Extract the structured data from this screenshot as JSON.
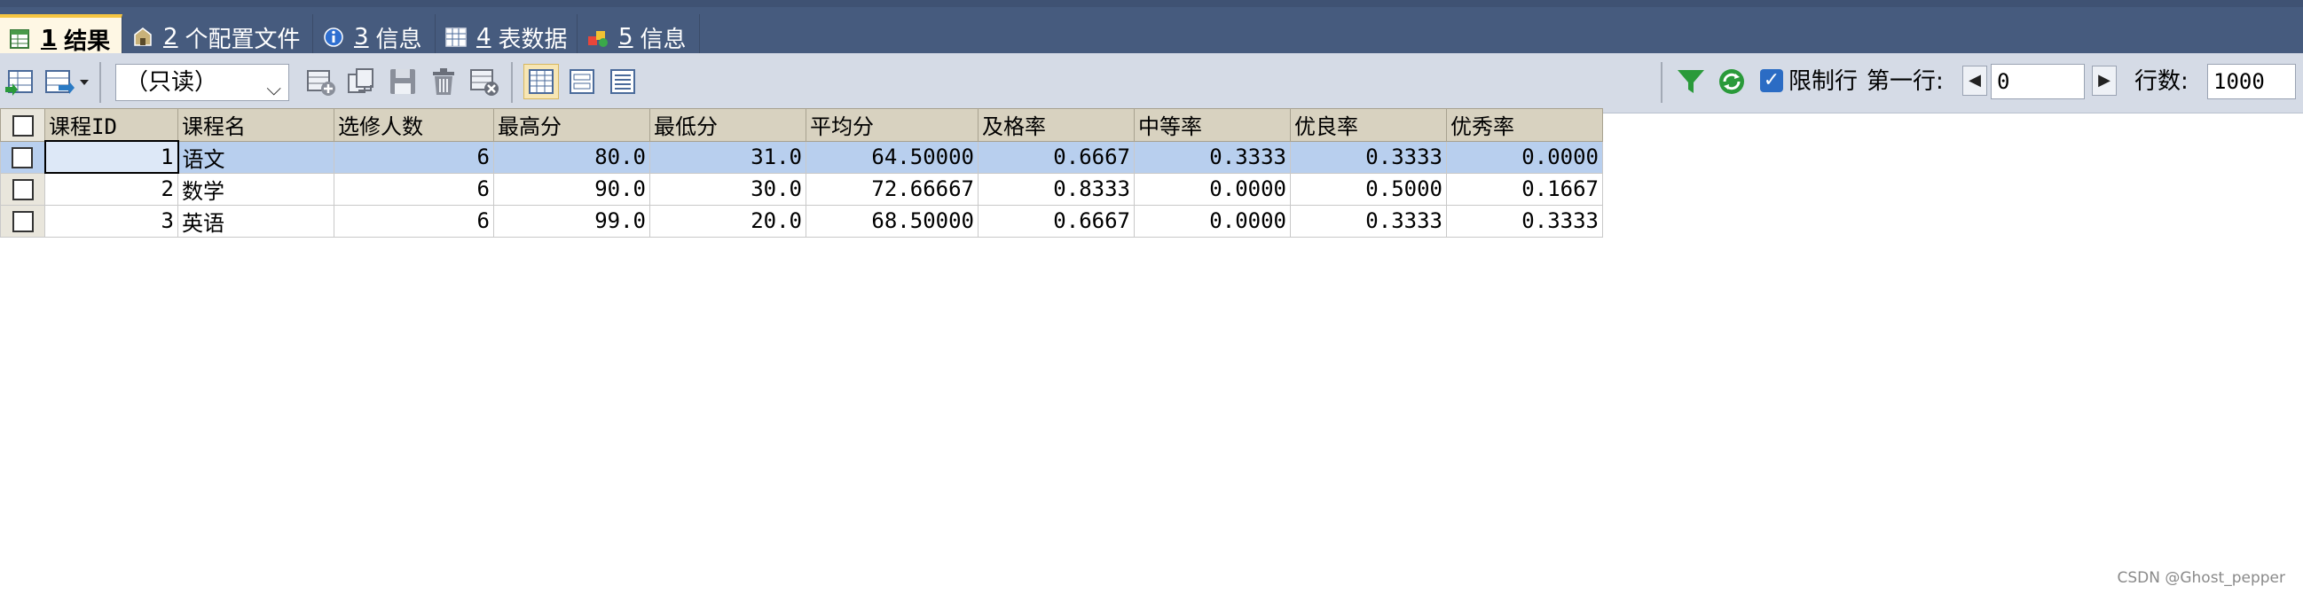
{
  "tabs": [
    {
      "num": "1",
      "label": "结果",
      "icon": "result-grid-icon"
    },
    {
      "num": "2",
      "label": "个配置文件",
      "icon": "profile-icon"
    },
    {
      "num": "3",
      "label": "信息",
      "icon": "info-icon"
    },
    {
      "num": "4",
      "label": "表数据",
      "icon": "table-data-icon"
    },
    {
      "num": "5",
      "label": "信息",
      "icon": "info-icon"
    }
  ],
  "toolbar": {
    "mode_select": "（只读）",
    "limit_label": "限制行",
    "limit_checked": true,
    "first_row_label": "第一行:",
    "first_row_value": "0",
    "row_count_label": "行数:",
    "row_count_value": "1000"
  },
  "table": {
    "headers": [
      "课程ID",
      "课程名",
      "选修人数",
      "最高分",
      "最低分",
      "平均分",
      "及格率",
      "中等率",
      "优良率",
      "优秀率"
    ],
    "rows": [
      [
        "1",
        "语文",
        "6",
        "80.0",
        "31.0",
        "64.50000",
        "0.6667",
        "0.3333",
        "0.3333",
        "0.0000"
      ],
      [
        "2",
        "数学",
        "6",
        "90.0",
        "30.0",
        "72.66667",
        "0.8333",
        "0.0000",
        "0.5000",
        "0.1667"
      ],
      [
        "3",
        "英语",
        "6",
        "99.0",
        "20.0",
        "68.50000",
        "0.6667",
        "0.0000",
        "0.3333",
        "0.3333"
      ]
    ]
  },
  "watermark": "CSDN @Ghost_pepper"
}
